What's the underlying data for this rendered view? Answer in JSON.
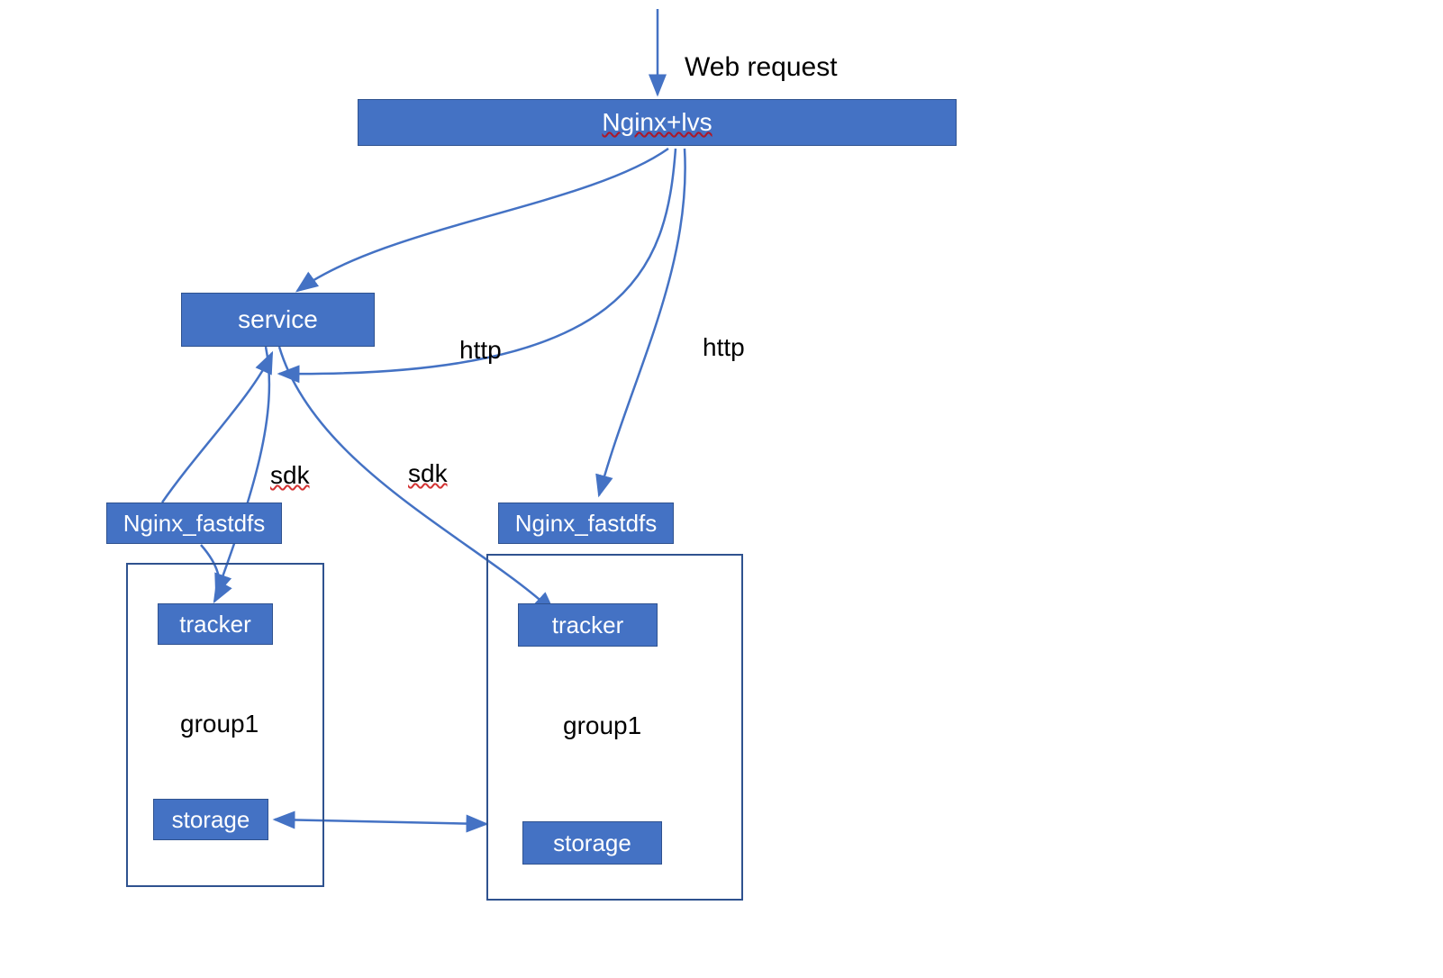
{
  "labels": {
    "web_request": "Web request",
    "http_left": "http",
    "http_right": "http",
    "sdk_left": "sdk",
    "sdk_right": "sdk",
    "group1_left": "group1",
    "group1_right": "group1"
  },
  "nodes": {
    "nginx_lvs": "Nginx+lvs",
    "service": "service",
    "nginx_fastdfs_left": "Nginx_fastdfs",
    "nginx_fastdfs_right": "Nginx_fastdfs",
    "tracker_left": "tracker",
    "tracker_right": "tracker",
    "storage_left": "storage",
    "storage_right": "storage"
  },
  "colors": {
    "node_fill": "#4472c4",
    "node_border": "#2f528f",
    "arrow": "#4472c4",
    "text_light": "#ffffff",
    "text_dark": "#000000"
  },
  "diagram": {
    "type": "architecture",
    "description": "FastDFS distributed file system architecture with Nginx load balancer, service layer, and replicated tracker/storage groups"
  }
}
